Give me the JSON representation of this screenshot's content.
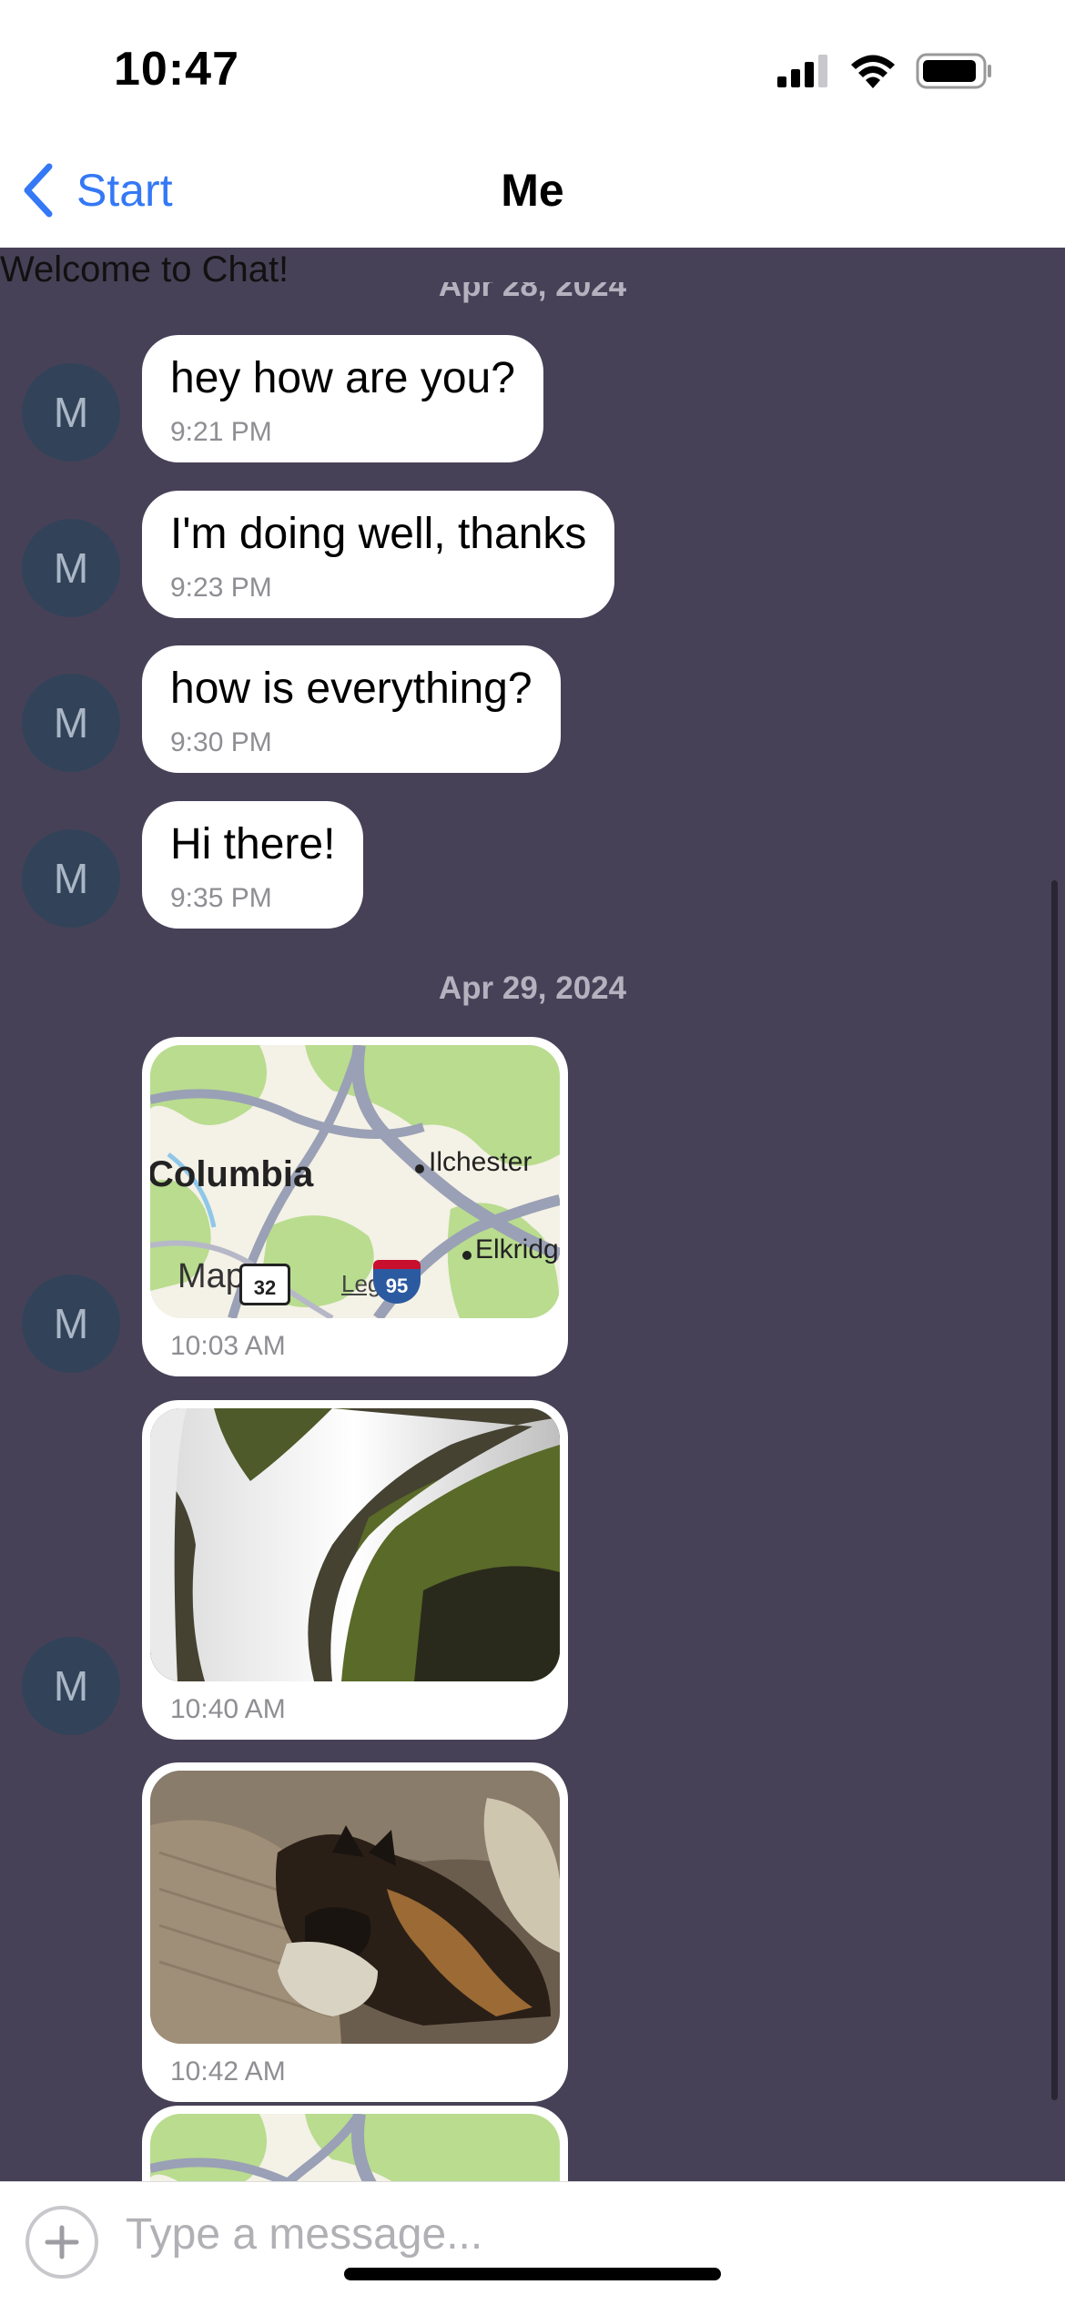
{
  "status_bar": {
    "time": "10:47",
    "signal_icon": "cellular-signal-icon",
    "wifi_icon": "wifi-icon",
    "battery_icon": "battery-icon"
  },
  "nav": {
    "back_label": "Start",
    "back_icon": "chevron-left-icon",
    "title": "Me"
  },
  "chat": {
    "welcome": "Welcome to Chat!",
    "date_top": "Apr 28, 2024",
    "date_second": "Apr 29, 2024",
    "avatar_initial": "M",
    "messages": [
      {
        "text": "hey how are you?",
        "time": "9:21 PM"
      },
      {
        "text": "I'm doing well, thanks",
        "time": "9:23 PM"
      },
      {
        "text": "how is everything?",
        "time": "9:30 PM"
      },
      {
        "text": "Hi there!",
        "time": "9:35 PM"
      }
    ],
    "media": [
      {
        "kind": "map",
        "time": "10:03 AM"
      },
      {
        "kind": "photo-waterfall",
        "time": "10:40 AM"
      },
      {
        "kind": "photo-dog",
        "time": "10:42 AM"
      },
      {
        "kind": "map"
      }
    ],
    "map": {
      "city": "Columbia",
      "place_1": "Ilchester",
      "place_2": "Elkridg",
      "attribution": "Maps",
      "legal": "Legal",
      "route_1": "32",
      "route_2": "95"
    }
  },
  "input": {
    "placeholder": "Type a message...",
    "add_icon": "plus-circle-icon"
  },
  "colors": {
    "accent": "#3478f6",
    "chat_background": "#474157",
    "avatar": "#324359",
    "bubble": "#ffffff"
  }
}
